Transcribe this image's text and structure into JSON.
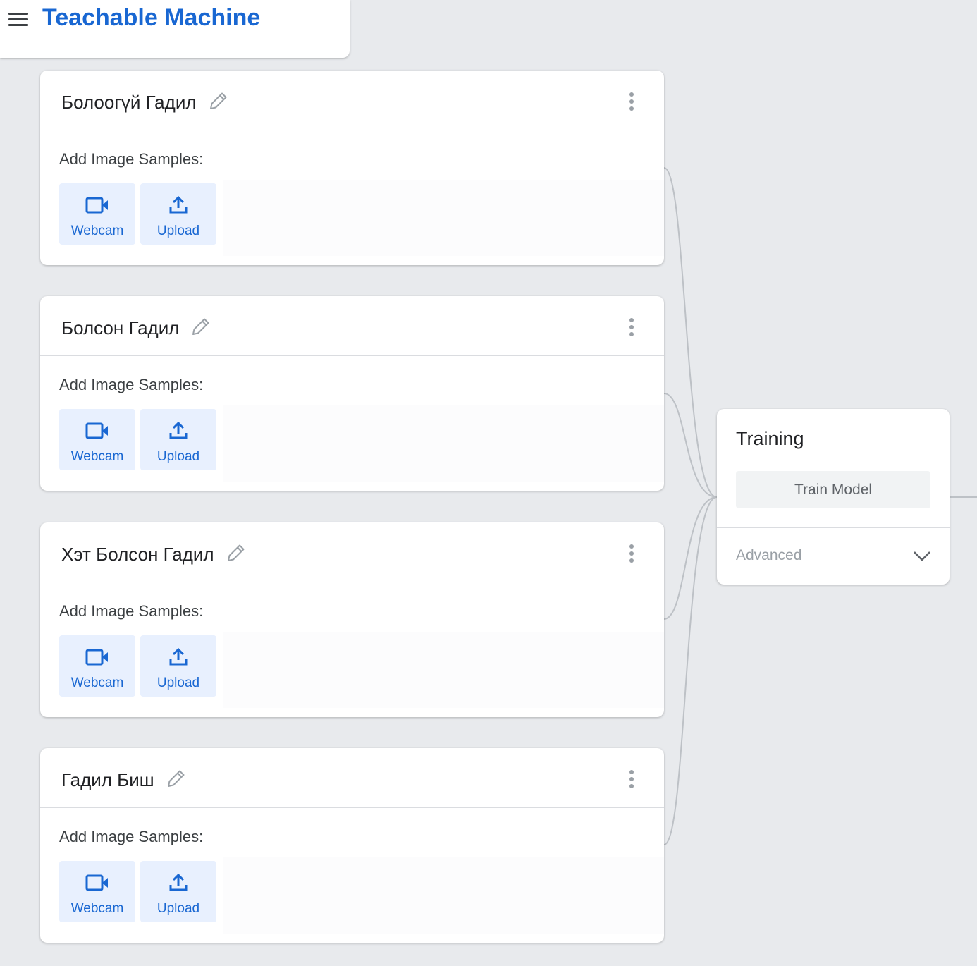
{
  "app": {
    "title": "Teachable Machine"
  },
  "classes": [
    {
      "name": "Болоогүй Гадил",
      "samples_label": "Add Image Samples:",
      "webcam_label": "Webcam",
      "upload_label": "Upload"
    },
    {
      "name": "Болсон Гадил",
      "samples_label": "Add Image Samples:",
      "webcam_label": "Webcam",
      "upload_label": "Upload"
    },
    {
      "name": "Хэт Болсон Гадил",
      "samples_label": "Add Image Samples:",
      "webcam_label": "Webcam",
      "upload_label": "Upload"
    },
    {
      "name": "Гадил Биш",
      "samples_label": "Add Image Samples:",
      "webcam_label": "Webcam",
      "upload_label": "Upload"
    }
  ],
  "training": {
    "title": "Training",
    "train_button": "Train Model",
    "advanced_label": "Advanced"
  },
  "icons": {
    "menu": "menu-icon",
    "edit": "pencil-icon",
    "more": "more-vert-icon",
    "webcam": "videocam-icon",
    "upload": "upload-icon",
    "chevron": "chevron-down-icon"
  },
  "colors": {
    "brand": "#1967d2",
    "background": "#e8eaed",
    "button_bg": "#e8f0fe",
    "muted": "#9aa0a6"
  }
}
